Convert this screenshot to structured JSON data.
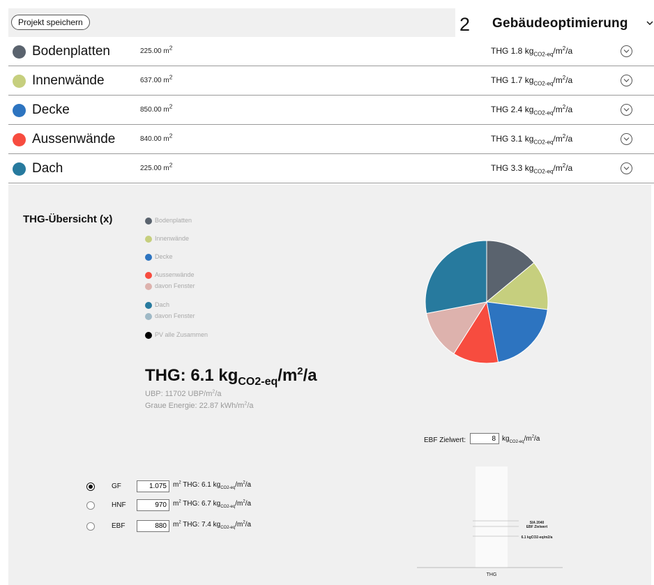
{
  "toolbar": {
    "save_label": "Projekt speichern"
  },
  "step": {
    "number": "2",
    "title": "Gebäudeoptimierung",
    "chevron": "chevron-down-icon"
  },
  "unit": {
    "kg": "kg",
    "co2": "CO2-eq",
    "per_m": "/m",
    "per_a": "/a",
    "m": "m",
    "sq": "2"
  },
  "elements": [
    {
      "name": "Bodenplatten",
      "area": "225.00 m",
      "thg_prefix": "THG 1.8 ",
      "color": "#5a636e"
    },
    {
      "name": "Innenwände",
      "area": "637.00 m",
      "thg_prefix": "THG 1.7 ",
      "color": "#c6cf7e"
    },
    {
      "name": "Decke",
      "area": "850.00 m",
      "thg_prefix": "THG 2.4 ",
      "color": "#2d74c0"
    },
    {
      "name": "Aussenwände",
      "area": "840.00 m",
      "thg_prefix": "THG 3.1 ",
      "color": "#f74c3f"
    },
    {
      "name": "Dach",
      "area": "225.00 m",
      "thg_prefix": "THG 3.3 ",
      "color": "#277a9e"
    }
  ],
  "overview": {
    "title": "THG-Übersicht (x)",
    "legend": [
      {
        "label": "Bodenplatten",
        "color": "#5a636e"
      },
      {
        "label": "Innenwände",
        "color": "#c6cf7e"
      },
      {
        "label": "Decke",
        "color": "#2d74c0"
      },
      {
        "label": "Aussenwände",
        "color": "#f74c3f"
      },
      {
        "label": "davon Fenster",
        "color": "#ddb2ad"
      },
      {
        "label": "Dach",
        "color": "#277a9e"
      },
      {
        "label": "davon Fenster",
        "color": "#9fb9c6"
      },
      {
        "label": "PV alle Zusammen",
        "color": "#000000"
      }
    ],
    "thg_prefix": "THG: 6.1 ",
    "ubp_prefix": "UBP: 11702 UBP/m",
    "ubp_suffix": "/a",
    "grey_prefix": "Graue Energie: 22.87 kWh/m",
    "grey_suffix": "/a"
  },
  "pie": {
    "slices": [
      {
        "label": "Bodenplatten",
        "value": 14,
        "color": "#5a636e"
      },
      {
        "label": "Innenwände",
        "value": 13,
        "color": "#c6cf7e"
      },
      {
        "label": "Decke",
        "value": 20,
        "color": "#2d74c0"
      },
      {
        "label": "Aussenwände",
        "value": 12,
        "color": "#f74c3f"
      },
      {
        "label": "davon Fenster",
        "value": 13,
        "color": "#ddb2ad"
      },
      {
        "label": "Dach",
        "value": 28,
        "color": "#277a9e"
      }
    ]
  },
  "target": {
    "label": "EBF Zielwert:",
    "value": "8"
  },
  "reference_options": [
    {
      "label": "GF",
      "value": "1.075",
      "thg_prefix": "THG: 6.1 ",
      "selected": true
    },
    {
      "label": "HNF",
      "value": "970",
      "thg_prefix": "THG: 6.7 ",
      "selected": false
    },
    {
      "label": "EBF",
      "value": "880",
      "thg_prefix": "THG: 7.4 ",
      "selected": false
    }
  ],
  "bar": {
    "axis_label": "THG",
    "line1_label": "SIA 2040",
    "line2_label": "EBF Zielwert",
    "line3_label": "6.1 kgCO2-eq/m2/a",
    "colors": {
      "bar": "#fafafa",
      "line": "#cccccc"
    }
  }
}
